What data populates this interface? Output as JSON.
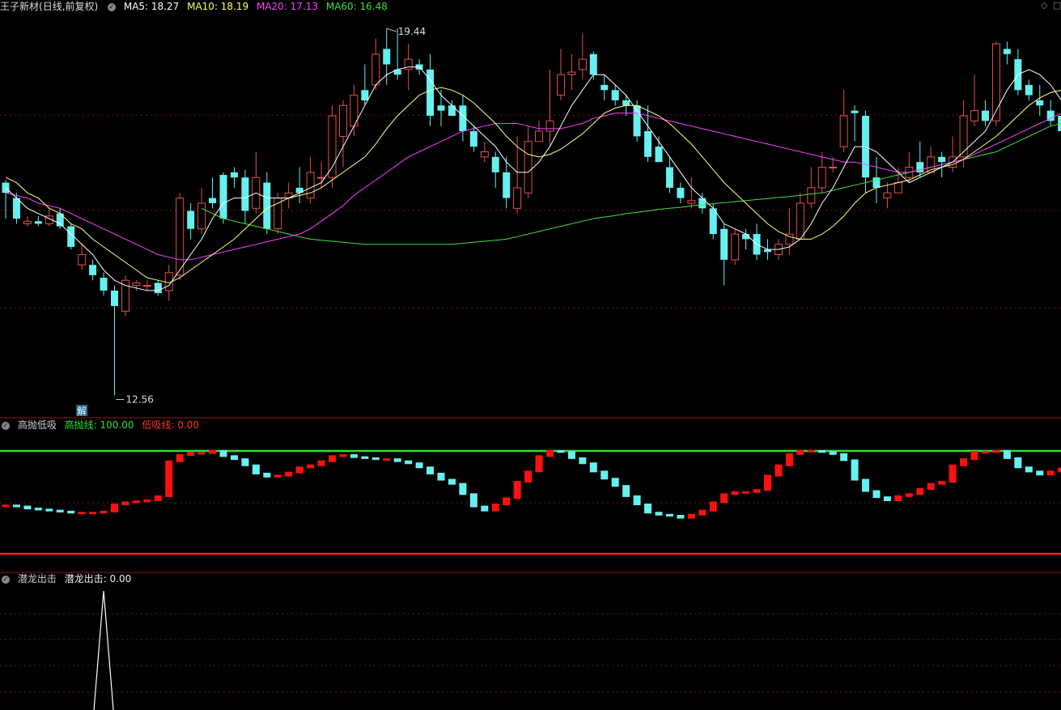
{
  "main_panel": {
    "stock_name": "王子新材",
    "period": "(日线,前复权)",
    "ma5_label": "MA5: 18.27",
    "ma10_label": "MA10: 18.19",
    "ma20_label": "MA20: 17.13",
    "ma60_label": "MA60: 16.48",
    "high_marker": "19.44",
    "low_marker": "12.56",
    "jie_badge": "解"
  },
  "indicator1": {
    "name": "高抛低吸",
    "high_label": "高抛线: 100.00",
    "low_label": "低吸线: 0.00"
  },
  "indicator2": {
    "name": "潜龙出击",
    "value_label": "潜龙出击: 0.00"
  },
  "window_controls": {
    "diamond": "◇",
    "square": "□"
  },
  "colors": {
    "up": "#e05050",
    "down": "#66f0f0",
    "ma5": "#ffffff",
    "ma10": "#ffff80",
    "ma20": "#ff40ff",
    "ma60": "#40e040",
    "high_line": "#30e030",
    "low_line": "#ff2020",
    "grid": "#7a1515"
  },
  "chart_data": {
    "type": "candlestick",
    "price_range": [
      12.3,
      20.0
    ],
    "candles": [
      [
        16.7,
        16.5,
        16.75,
        16.0
      ],
      [
        16.4,
        16.0,
        16.5,
        15.9
      ],
      [
        15.9,
        15.95,
        16.05,
        15.85
      ],
      [
        15.95,
        15.9,
        16.05,
        15.85
      ],
      [
        15.9,
        16.05,
        16.2,
        15.85
      ],
      [
        16.1,
        15.85,
        16.2,
        15.8
      ],
      [
        15.85,
        15.45,
        15.9,
        15.4
      ],
      [
        15.1,
        15.3,
        15.5,
        15.0
      ],
      [
        15.1,
        14.9,
        15.2,
        14.8
      ],
      [
        14.85,
        14.6,
        14.95,
        14.5
      ],
      [
        14.6,
        14.3,
        14.7,
        12.56
      ],
      [
        14.2,
        14.8,
        14.9,
        14.1
      ],
      [
        14.7,
        14.75,
        14.8,
        14.6
      ],
      [
        14.7,
        14.7,
        14.8,
        14.6
      ],
      [
        14.75,
        14.55,
        14.8,
        14.5
      ],
      [
        14.6,
        14.95,
        15.1,
        14.4
      ],
      [
        14.9,
        16.4,
        16.5,
        14.8
      ],
      [
        16.15,
        15.8,
        16.3,
        15.6
      ],
      [
        15.8,
        16.3,
        16.6,
        15.7
      ],
      [
        16.4,
        16.3,
        16.8,
        16.2
      ],
      [
        16.85,
        16.0,
        16.9,
        15.9
      ],
      [
        16.9,
        16.8,
        17.0,
        16.6
      ],
      [
        16.8,
        16.15,
        16.95,
        15.9
      ],
      [
        16.2,
        16.8,
        17.3,
        16.1
      ],
      [
        16.7,
        15.8,
        16.9,
        15.7
      ],
      [
        15.8,
        16.4,
        16.5,
        15.7
      ],
      [
        16.4,
        16.5,
        16.7,
        16.2
      ],
      [
        16.6,
        16.5,
        17.0,
        16.3
      ],
      [
        16.4,
        16.9,
        17.2,
        16.3
      ],
      [
        16.8,
        16.8,
        17.1,
        16.6
      ],
      [
        16.8,
        18.0,
        18.2,
        16.6
      ],
      [
        17.6,
        18.2,
        18.3,
        17.0
      ],
      [
        17.8,
        18.4,
        18.6,
        17.6
      ],
      [
        18.5,
        18.3,
        19.0,
        18.2
      ],
      [
        18.6,
        19.2,
        19.5,
        18.5
      ],
      [
        19.3,
        19.0,
        19.7,
        18.6
      ],
      [
        18.9,
        18.8,
        19.7,
        18.7
      ],
      [
        18.9,
        19.1,
        19.4,
        18.5
      ],
      [
        19.0,
        18.9,
        19.1,
        18.8
      ],
      [
        18.9,
        18.0,
        19.2,
        17.8
      ],
      [
        18.2,
        18.1,
        18.5,
        17.8
      ],
      [
        18.2,
        18.0,
        18.3,
        18.0
      ],
      [
        18.2,
        17.7,
        18.4,
        17.5
      ],
      [
        17.7,
        17.4,
        17.8,
        17.3
      ],
      [
        17.2,
        17.3,
        17.5,
        17.1
      ],
      [
        17.2,
        16.9,
        17.3,
        16.6
      ],
      [
        16.9,
        16.4,
        17.2,
        16.2
      ],
      [
        16.2,
        16.6,
        17.6,
        16.1
      ],
      [
        16.5,
        17.5,
        17.8,
        16.4
      ],
      [
        17.5,
        17.7,
        17.9,
        17.5
      ],
      [
        17.7,
        17.9,
        18.9,
        17.4
      ],
      [
        18.4,
        18.8,
        19.3,
        18.3
      ],
      [
        18.8,
        18.85,
        19.2,
        18.5
      ],
      [
        18.9,
        19.1,
        19.6,
        18.7
      ],
      [
        19.2,
        18.8,
        19.25,
        18.7
      ],
      [
        18.6,
        18.5,
        18.8,
        18.3
      ],
      [
        18.5,
        18.3,
        18.6,
        18.2
      ],
      [
        18.3,
        18.2,
        18.4,
        18.0
      ],
      [
        18.2,
        17.6,
        18.3,
        17.5
      ],
      [
        17.7,
        17.2,
        18.2,
        17.1
      ],
      [
        17.4,
        17.1,
        17.6,
        17.1
      ],
      [
        17.0,
        16.6,
        17.2,
        16.5
      ],
      [
        16.6,
        16.4,
        16.7,
        16.3
      ],
      [
        16.3,
        16.35,
        16.8,
        16.2
      ],
      [
        16.4,
        16.2,
        16.5,
        16.1
      ],
      [
        16.2,
        15.7,
        16.3,
        15.6
      ],
      [
        15.8,
        15.2,
        15.9,
        14.7
      ],
      [
        15.2,
        15.7,
        15.8,
        15.1
      ],
      [
        15.7,
        15.6,
        15.8,
        15.4
      ],
      [
        15.7,
        15.3,
        15.9,
        15.2
      ],
      [
        15.4,
        15.35,
        15.6,
        15.2
      ],
      [
        15.3,
        15.5,
        15.6,
        15.2
      ],
      [
        15.5,
        15.7,
        16.2,
        15.3
      ],
      [
        15.6,
        16.3,
        16.5,
        15.6
      ],
      [
        16.3,
        16.6,
        17.0,
        16.2
      ],
      [
        16.6,
        17.0,
        17.3,
        16.5
      ],
      [
        17.0,
        17.0,
        17.2,
        16.9
      ],
      [
        17.4,
        18.0,
        18.5,
        17.3
      ],
      [
        18.1,
        18.05,
        18.2,
        17.5
      ],
      [
        18.0,
        16.8,
        18.1,
        16.5
      ],
      [
        16.8,
        16.6,
        17.2,
        16.3
      ],
      [
        16.4,
        16.5,
        16.7,
        16.2
      ],
      [
        16.5,
        16.7,
        17.0,
        16.5
      ],
      [
        16.8,
        17.0,
        17.3,
        16.7
      ],
      [
        17.1,
        16.9,
        17.5,
        16.8
      ],
      [
        16.9,
        17.2,
        17.4,
        16.9
      ],
      [
        17.2,
        17.1,
        17.3,
        16.8
      ],
      [
        17.0,
        17.2,
        17.6,
        16.9
      ],
      [
        17.2,
        18.0,
        18.3,
        17.0
      ],
      [
        17.9,
        18.1,
        18.8,
        17.8
      ],
      [
        18.1,
        17.9,
        18.3,
        17.8
      ],
      [
        17.9,
        19.4,
        19.44,
        17.8
      ],
      [
        19.3,
        19.2,
        19.44,
        19.0
      ],
      [
        19.1,
        18.5,
        19.3,
        18.4
      ],
      [
        18.6,
        18.4,
        18.7,
        18.3
      ],
      [
        18.3,
        18.2,
        18.6,
        18.0
      ],
      [
        18.1,
        17.9,
        18.3,
        17.8
      ],
      [
        18.0,
        17.7,
        18.4,
        17.5
      ],
      [
        18.27,
        18.3,
        18.5,
        18.1
      ]
    ],
    "ma5": [
      16.6,
      16.4,
      16.2,
      16.1,
      16.0,
      15.9,
      15.7,
      15.5,
      15.3,
      15.0,
      14.8,
      14.7,
      14.65,
      14.6,
      14.6,
      14.7,
      15.0,
      15.3,
      15.6,
      16.0,
      16.3,
      16.4,
      16.4,
      16.5,
      16.4,
      16.4,
      16.4,
      16.5,
      16.6,
      16.7,
      17.0,
      17.4,
      17.8,
      18.2,
      18.6,
      18.8,
      18.9,
      18.95,
      18.95,
      18.7,
      18.4,
      18.2,
      18.0,
      17.8,
      17.6,
      17.4,
      17.1,
      16.9,
      16.9,
      17.1,
      17.4,
      17.8,
      18.2,
      18.5,
      18.8,
      18.8,
      18.6,
      18.4,
      18.1,
      17.8,
      17.5,
      17.2,
      16.9,
      16.6,
      16.4,
      16.2,
      15.9,
      15.8,
      15.7,
      15.5,
      15.4,
      15.4,
      15.45,
      15.6,
      15.9,
      16.3,
      16.6,
      17.0,
      17.4,
      17.4,
      17.3,
      17.1,
      16.9,
      16.7,
      16.8,
      16.9,
      17.0,
      17.1,
      17.3,
      17.5,
      17.7,
      18.1,
      18.5,
      18.8,
      18.9,
      18.8,
      18.6,
      18.3,
      18.2
    ],
    "ma10": [
      16.8,
      16.7,
      16.5,
      16.4,
      16.2,
      16.1,
      15.9,
      15.8,
      15.6,
      15.45,
      15.3,
      15.15,
      15.0,
      14.85,
      14.8,
      14.75,
      14.85,
      15.0,
      15.15,
      15.3,
      15.45,
      15.6,
      15.8,
      16.0,
      16.2,
      16.3,
      16.4,
      16.45,
      16.5,
      16.6,
      16.75,
      16.9,
      17.05,
      17.2,
      17.45,
      17.75,
      18.0,
      18.2,
      18.4,
      18.5,
      18.55,
      18.5,
      18.4,
      18.25,
      18.05,
      17.85,
      17.6,
      17.4,
      17.25,
      17.2,
      17.25,
      17.35,
      17.5,
      17.65,
      17.85,
      18.05,
      18.15,
      18.2,
      18.2,
      18.1,
      18.0,
      17.85,
      17.65,
      17.45,
      17.2,
      16.95,
      16.7,
      16.5,
      16.3,
      16.1,
      15.9,
      15.75,
      15.65,
      15.6,
      15.6,
      15.7,
      15.85,
      16.05,
      16.3,
      16.5,
      16.6,
      16.65,
      16.7,
      16.75,
      16.85,
      16.95,
      17.0,
      17.05,
      17.15,
      17.3,
      17.45,
      17.6,
      17.8,
      18.0,
      18.2,
      18.35,
      18.45,
      18.5,
      18.5
    ],
    "ma20": [
      16.5,
      16.45,
      16.4,
      16.3,
      16.25,
      16.2,
      16.1,
      16.0,
      15.9,
      15.8,
      15.7,
      15.6,
      15.5,
      15.4,
      15.3,
      15.25,
      15.2,
      15.2,
      15.25,
      15.3,
      15.35,
      15.4,
      15.45,
      15.5,
      15.55,
      15.6,
      15.65,
      15.7,
      15.8,
      15.95,
      16.1,
      16.25,
      16.45,
      16.6,
      16.75,
      16.9,
      17.05,
      17.2,
      17.3,
      17.4,
      17.5,
      17.6,
      17.7,
      17.75,
      17.8,
      17.85,
      17.85,
      17.85,
      17.8,
      17.75,
      17.75,
      17.75,
      17.8,
      17.85,
      17.95,
      18.0,
      18.05,
      18.05,
      18.05,
      18.0,
      17.95,
      17.9,
      17.85,
      17.8,
      17.75,
      17.7,
      17.65,
      17.6,
      17.55,
      17.5,
      17.45,
      17.4,
      17.35,
      17.3,
      17.25,
      17.2,
      17.15,
      17.1,
      17.1,
      17.05,
      17.0,
      16.95,
      16.9,
      16.9,
      16.95,
      17.0,
      17.05,
      17.1,
      17.15,
      17.25,
      17.35,
      17.45,
      17.55,
      17.65,
      17.75,
      17.85,
      17.95,
      18.05,
      18.15
    ],
    "ma60": [
      null,
      null,
      null,
      null,
      null,
      null,
      null,
      null,
      null,
      null,
      null,
      null,
      null,
      null,
      null,
      null,
      null,
      null,
      16.2,
      16.1,
      16.0,
      15.95,
      15.9,
      15.85,
      15.8,
      15.75,
      15.7,
      15.65,
      15.6,
      15.58,
      15.56,
      15.54,
      15.52,
      15.5,
      15.5,
      15.5,
      15.5,
      15.5,
      15.5,
      15.5,
      15.5,
      15.5,
      15.52,
      15.54,
      15.56,
      15.58,
      15.6,
      15.65,
      15.7,
      15.75,
      15.8,
      15.85,
      15.9,
      15.95,
      16.0,
      16.03,
      16.06,
      16.1,
      16.12,
      16.15,
      16.18,
      16.2,
      16.22,
      16.25,
      16.27,
      16.29,
      16.31,
      16.33,
      16.35,
      16.37,
      16.39,
      16.41,
      16.43,
      16.45,
      16.48,
      16.5,
      16.55,
      16.6,
      16.65,
      16.7,
      16.75,
      16.8,
      16.85,
      16.9,
      16.95,
      17.0,
      17.05,
      17.1,
      17.15,
      17.2,
      17.25,
      17.3,
      17.4,
      17.5,
      17.6,
      17.7,
      17.8,
      17.85,
      17.9
    ]
  },
  "indicator1_data": [
    47,
    46,
    44,
    43,
    42,
    41,
    40,
    40,
    40,
    41,
    48,
    50,
    51,
    52,
    56,
    90,
    96,
    98,
    98,
    100,
    95,
    92,
    86,
    78,
    75,
    76,
    79,
    84,
    86,
    90,
    95,
    96,
    94,
    93,
    92,
    92,
    90,
    88,
    84,
    78,
    72,
    68,
    58,
    46,
    42,
    48,
    54,
    70,
    80,
    95,
    100,
    99,
    93,
    88,
    80,
    73,
    66,
    56,
    48,
    40,
    38,
    37,
    35,
    38,
    42,
    50,
    58,
    60,
    60,
    62,
    76,
    86,
    97,
    100,
    100,
    99,
    97,
    91,
    72,
    61,
    55,
    52,
    56,
    58,
    63,
    68,
    70,
    86,
    92,
    99,
    99,
    100,
    93,
    84,
    80,
    77,
    80,
    83,
    85
  ]
}
